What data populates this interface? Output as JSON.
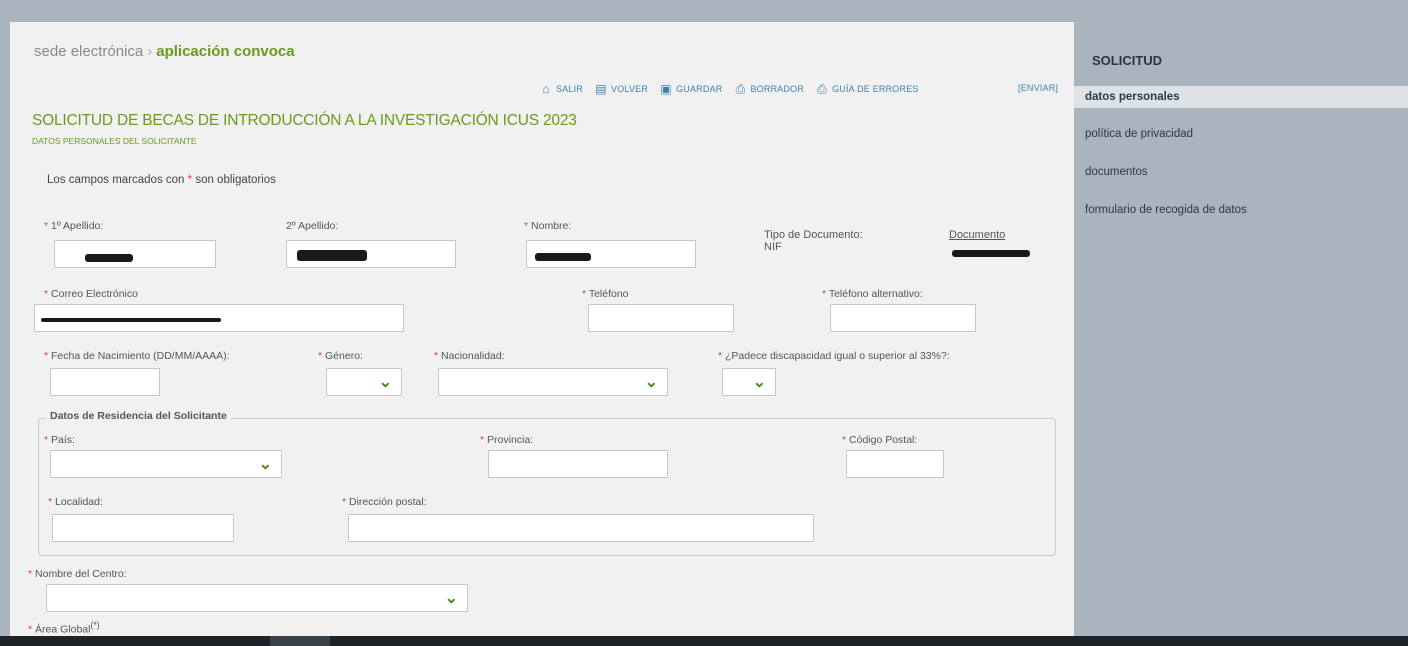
{
  "brand": {
    "prefix": "sede electrónica",
    "separator": "›",
    "app": "aplicación convoca"
  },
  "toolbar": {
    "salir": "SALIR",
    "volver": "VOLVER",
    "guardar": "GUARDAR",
    "borrador": "BORRADOR",
    "guia": "GUÍA DE ERRORES",
    "enviar": "[ENVIAR]"
  },
  "form": {
    "title": "SOLICITUD DE BECAS DE INTRODUCCIÓN A LA INVESTIGACIÓN ICUS 2023",
    "subtitle": "DATOS PERSONALES DEL SOLICITANTE",
    "required_note_pre": "Los campos marcados con",
    "required_star": "*",
    "required_note_post": " son obligatorios",
    "labels": {
      "apellido1": "1º Apellido:",
      "apellido2": "2º Apellido:",
      "nombre": "Nombre:",
      "tipo_documento": "Tipo de Documento:",
      "documento": "Documento",
      "correo": "Correo Electrónico",
      "telefono": "Teléfono",
      "telefono_alt": "Teléfono alternativo:",
      "fecha_nacimiento": "Fecha de Nacimiento (DD/MM/AAAA):",
      "genero": "Género:",
      "nacionalidad": "Nacionalidad:",
      "discapacidad": "¿Padece discapacidad igual o superior al 33%?:",
      "residencia": "Datos de Residencia del Solicitante",
      "pais": "País:",
      "provincia": "Provincia:",
      "codigo_postal": "Código Postal:",
      "localidad": "Localidad:",
      "direccion": "Dirección postal:",
      "centro": "Nombre del Centro:",
      "area": "Área Global",
      "area_note": "(*)"
    },
    "values": {
      "tipo_documento": "NIF"
    }
  },
  "sidebar": {
    "title": "SOLICITUD",
    "items": [
      {
        "label": "datos personales"
      },
      {
        "label": "política de privacidad"
      },
      {
        "label": "documentos"
      },
      {
        "label": "formulario de recogida de datos"
      }
    ]
  }
}
